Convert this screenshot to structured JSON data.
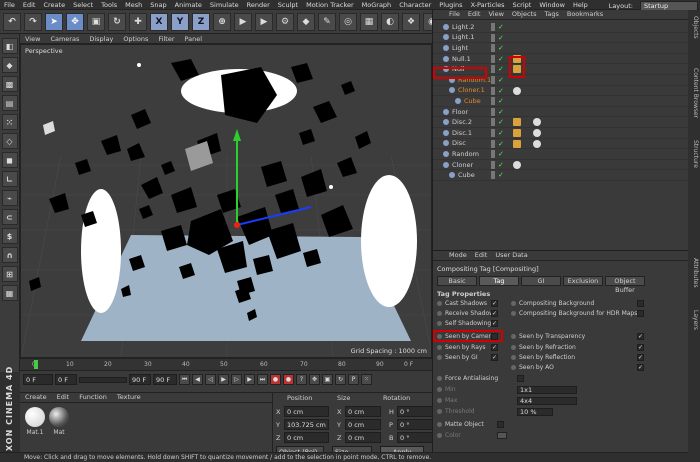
{
  "menu": [
    "File",
    "Edit",
    "Create",
    "Select",
    "Tools",
    "Mesh",
    "Snap",
    "Animate",
    "Simulate",
    "Render",
    "Sculpt",
    "Motion Tracker",
    "MoGraph",
    "Character",
    "Plugins",
    "X-Particles",
    "Script",
    "Window",
    "Help"
  ],
  "layout": {
    "label": "Layout:",
    "value": "Startup"
  },
  "toolbar": {
    "x": "X",
    "y": "Y",
    "z": "Z"
  },
  "viewport": {
    "menu": [
      "View",
      "Cameras",
      "Display",
      "Options",
      "Filter",
      "Panel"
    ],
    "label": "Perspective",
    "grid_spacing": "Grid Spacing : 1000 cm"
  },
  "timeline": {
    "ticks": [
      "0",
      "10",
      "20",
      "30",
      "40",
      "50",
      "60",
      "70",
      "80",
      "90"
    ],
    "end": "0 F"
  },
  "playbar": {
    "start": "0 F",
    "min": "0 F",
    "max": "90 F",
    "end": "90 F"
  },
  "material": {
    "menu": [
      "Create",
      "Edit",
      "Function",
      "Texture"
    ],
    "items": [
      "Mat.1",
      "Mat"
    ]
  },
  "coords": {
    "headers": [
      "Position",
      "Size",
      "Rotation"
    ],
    "rows": [
      {
        "axis": "X",
        "pos": "0 cm",
        "size_axis": "X",
        "size": "0 cm",
        "rot_axis": "H",
        "rot": "0 °"
      },
      {
        "axis": "Y",
        "pos": "103.725 cm",
        "size_axis": "Y",
        "size": "0 cm",
        "rot_axis": "P",
        "rot": "0 °"
      },
      {
        "axis": "Z",
        "pos": "0 cm",
        "size_axis": "Z",
        "size": "0 cm",
        "rot_axis": "B",
        "rot": "0 °"
      }
    ],
    "mode1": "Object (Rel)",
    "mode2": "Size",
    "apply": "Apply"
  },
  "objects": {
    "menu": [
      "File",
      "Edit",
      "View",
      "Objects",
      "Tags",
      "Bookmarks"
    ],
    "rows": [
      {
        "name": "Light.2",
        "indent": 0
      },
      {
        "name": "Light.1",
        "indent": 0
      },
      {
        "name": "Light",
        "indent": 0
      },
      {
        "name": "Null.1",
        "indent": 0
      },
      {
        "name": "Null",
        "indent": 0
      },
      {
        "name": "Random.1",
        "indent": 1
      },
      {
        "name": "Cloner.1",
        "indent": 1
      },
      {
        "name": "Cube",
        "indent": 2
      },
      {
        "name": "Floor",
        "indent": 0
      },
      {
        "name": "Disc.2",
        "indent": 0
      },
      {
        "name": "Disc.1",
        "indent": 0
      },
      {
        "name": "Disc",
        "indent": 0
      },
      {
        "name": "Random",
        "indent": 0
      },
      {
        "name": "Cloner",
        "indent": 0
      },
      {
        "name": "Cube",
        "indent": 1
      }
    ]
  },
  "attributes": {
    "menu": [
      "Mode",
      "Edit",
      "User Data"
    ],
    "title": "Compositing Tag [Compositing]",
    "tabs": [
      "Basic",
      "Tag",
      "GI",
      "Exclusion",
      "Object Buffer"
    ],
    "section": "Tag Properties",
    "left": [
      {
        "label": "Cast Shadows",
        "check": "✓"
      },
      {
        "label": "Receive Shadows",
        "check": "✓"
      },
      {
        "label": "Self Shadowing",
        "check": "✓"
      },
      {
        "label": "Seen by Camera",
        "check": ""
      },
      {
        "label": "Seen by Rays",
        "check": "✓"
      },
      {
        "label": "Seen by GI",
        "check": "✓"
      }
    ],
    "right": [
      {
        "label": "Compositing Background",
        "check": ""
      },
      {
        "label": "Compositing Background for HDR Maps",
        "check": ""
      },
      {
        "label": "Seen by Transparency",
        "check": "✓"
      },
      {
        "label": "Seen by Refraction",
        "check": "✓"
      },
      {
        "label": "Seen by Reflection",
        "check": "✓"
      },
      {
        "label": "Seen by AO",
        "check": "✓"
      }
    ],
    "force_aa": "Force Antialiasing",
    "min": "Min",
    "min_val": "1x1",
    "max": "Max",
    "max_val": "4x4",
    "threshold": "Threshold",
    "threshold_val": "10 %",
    "matte": "Matte Object",
    "color": "Color"
  },
  "side_tabs": [
    "Objects",
    "Content Browser",
    "Structure",
    "Attributes",
    "Layers"
  ],
  "brand": "MAXON CINEMA 4D",
  "status": "Move: Click and drag to move elements. Hold down SHIFT to quantize movement / add to the selection in point mode, CTRL to remove."
}
